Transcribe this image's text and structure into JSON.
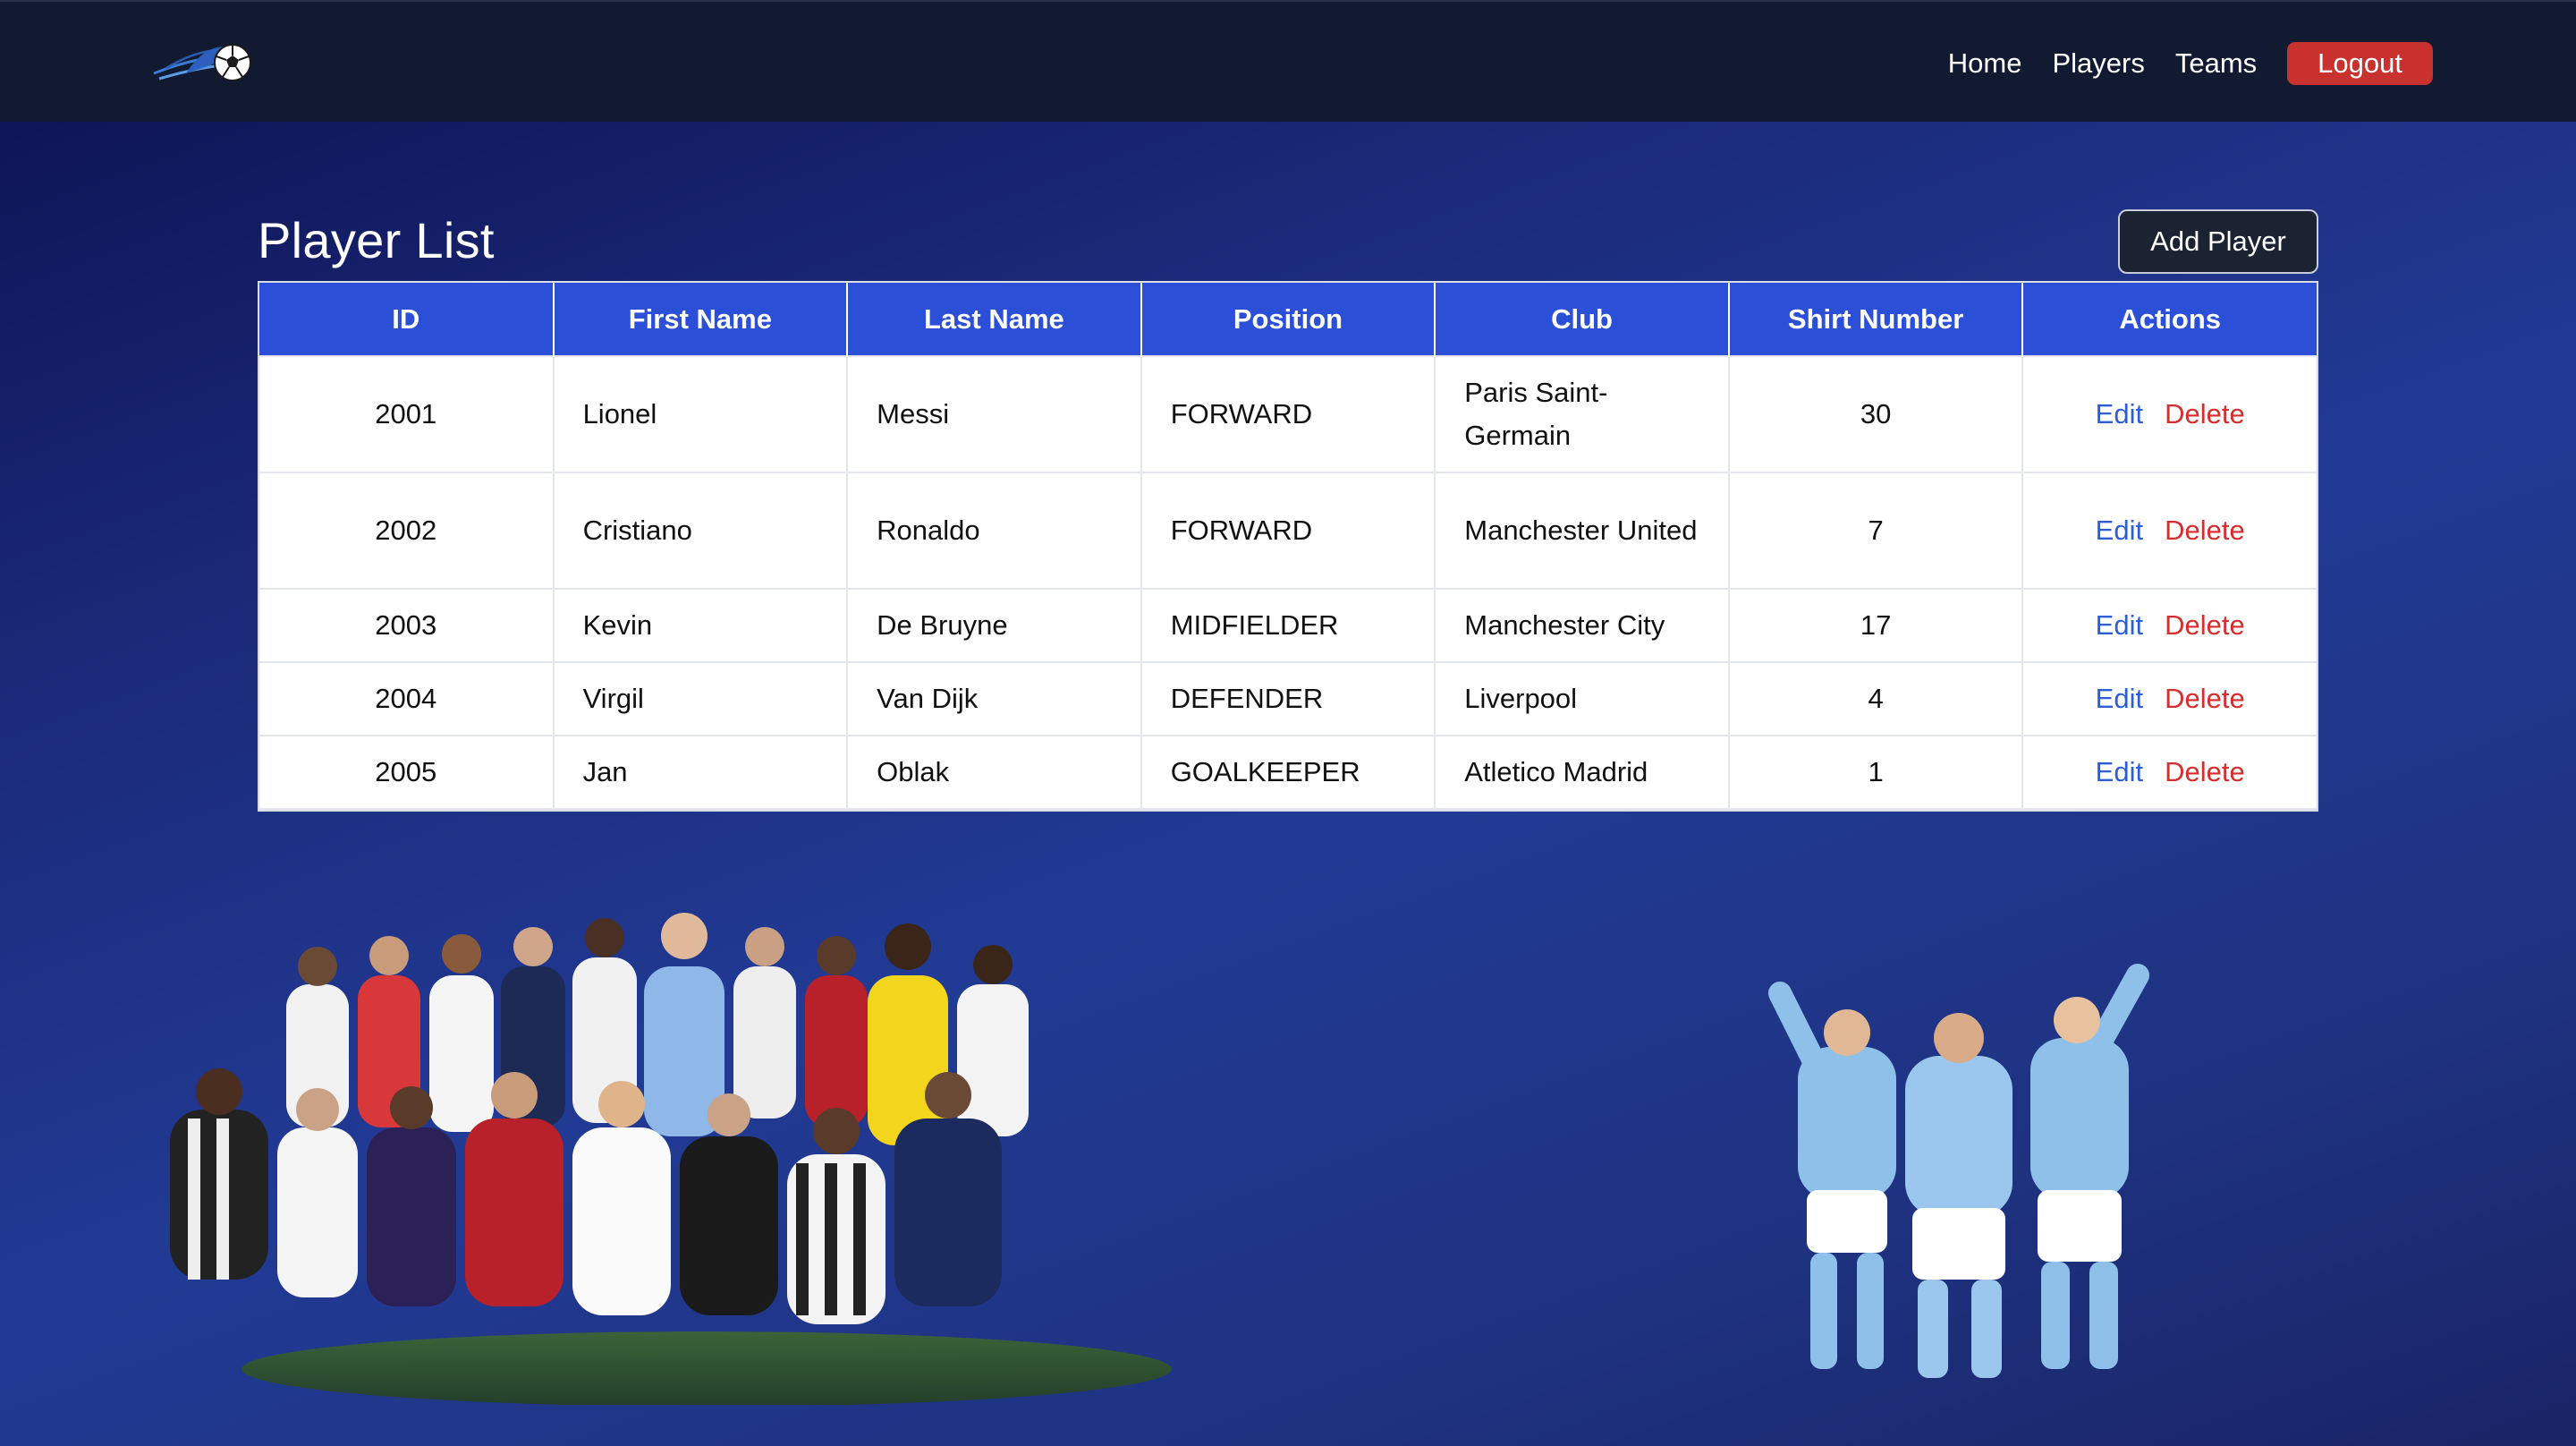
{
  "nav": {
    "links": [
      "Home",
      "Players",
      "Teams"
    ],
    "logout_label": "Logout"
  },
  "page": {
    "title": "Player List",
    "add_label": "Add Player"
  },
  "table": {
    "columns": [
      "ID",
      "First Name",
      "Last Name",
      "Position",
      "Club",
      "Shirt Number",
      "Actions"
    ],
    "rows": [
      {
        "id": "2001",
        "first": "Lionel",
        "last": "Messi",
        "position": "FORWARD",
        "club": "Paris Saint-Germain",
        "shirt": "30",
        "edit": "Edit",
        "delete": "Delete"
      },
      {
        "id": "2002",
        "first": "Cristiano",
        "last": "Ronaldo",
        "position": "FORWARD",
        "club": "Manchester United",
        "shirt": "7",
        "edit": "Edit",
        "delete": "Delete"
      },
      {
        "id": "2003",
        "first": "Kevin",
        "last": "De Bruyne",
        "position": "MIDFIELDER",
        "club": "Manchester City",
        "shirt": "17",
        "edit": "Edit",
        "delete": "Delete"
      },
      {
        "id": "2004",
        "first": "Virgil",
        "last": "Van Dijk",
        "position": "DEFENDER",
        "club": "Liverpool",
        "shirt": "4",
        "edit": "Edit",
        "delete": "Delete"
      },
      {
        "id": "2005",
        "first": "Jan",
        "last": "Oblak",
        "position": "GOALKEEPER",
        "club": "Atletico Madrid",
        "shirt": "1",
        "edit": "Edit",
        "delete": "Delete"
      }
    ]
  },
  "colors": {
    "navbar": "#121a31",
    "table_header": "#2b4fd6",
    "logout": "#c8312d",
    "edit": "#2b5fd9",
    "delete": "#d62d2d"
  },
  "icons": {
    "logo": "soccer-ball-logo-icon"
  }
}
